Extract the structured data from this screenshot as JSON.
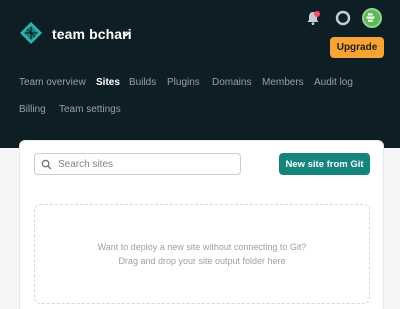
{
  "team": {
    "name": "team bchari"
  },
  "header": {
    "upgrade_label": "Upgrade",
    "icons": {
      "notifications": "bell-icon",
      "help": "lifebuoy-icon",
      "avatar": "user-avatar"
    },
    "notification_dot_color": "#ff4d6a"
  },
  "nav": {
    "tabs": [
      {
        "label": "Team overview",
        "active": false
      },
      {
        "label": "Sites",
        "active": true
      },
      {
        "label": "Builds",
        "active": false
      },
      {
        "label": "Plugins",
        "active": false
      },
      {
        "label": "Domains",
        "active": false
      },
      {
        "label": "Members",
        "active": false
      },
      {
        "label": "Audit log",
        "active": false
      },
      {
        "label": "Billing",
        "active": false
      },
      {
        "label": "Team settings",
        "active": false
      }
    ]
  },
  "main": {
    "search": {
      "placeholder": "Search sites",
      "value": ""
    },
    "new_site_label": "New site from Git",
    "dropzone": {
      "line1": "Want to deploy a new site without connecting to Git?",
      "line2": "Drag and drop your site output folder here"
    }
  },
  "colors": {
    "header_bg": "#0e1e25",
    "accent_teal": "#15847d",
    "upgrade_orange": "#f8a435"
  }
}
